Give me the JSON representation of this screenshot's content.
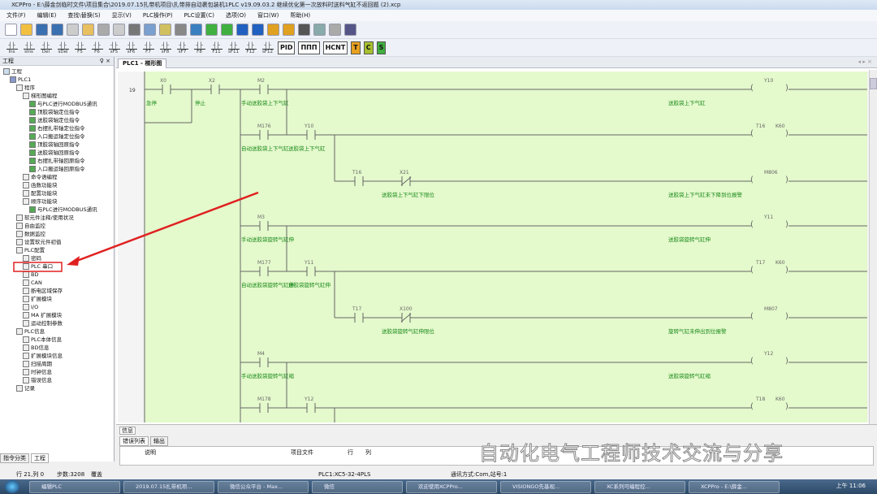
{
  "window": {
    "title": "XCPPro - E:\\薛金剑临时文件\\项目集合\\2019.07.15扎带机项目\\扎带排自动裹包装机1PLC v19.09.03.2 继续优化第一次放料时送料气缸不返回题 (2).xcp"
  },
  "menu": [
    "文件(F)",
    "编辑(E)",
    "查找\\替换(S)",
    "显示(V)",
    "PLC操作(P)",
    "PLC设置(C)",
    "选项(O)",
    "窗口(W)",
    "帮助(H)"
  ],
  "toolbar2": [
    "Ins",
    "sIns",
    "Del",
    "sDel",
    "F5",
    "F6",
    "sF5",
    "sF6",
    "F7",
    "sF8",
    "sF7",
    "F8",
    "F11",
    "sF11",
    "F12",
    "sF12"
  ],
  "toolbar2_big": [
    "PID",
    "ΠΠΠ",
    "HCNT",
    "T",
    "C",
    "S"
  ],
  "left_panel": {
    "title": "工程",
    "pin": "♀ ×",
    "tabs": [
      "指令分类",
      "工程"
    ]
  },
  "tree": [
    {
      "label": "工程",
      "level": 0
    },
    {
      "label": "PLC1",
      "level": 1
    },
    {
      "label": "程序",
      "level": 2
    },
    {
      "label": "梯形图编程",
      "level": 3
    },
    {
      "label": "与PLC进行MODBUS通讯",
      "level": 4
    },
    {
      "label": "顶胶袋轴定位指令",
      "level": 4
    },
    {
      "label": "送胶袋轴定位指令",
      "level": 4
    },
    {
      "label": "右摆扎带轴定位指令",
      "level": 4
    },
    {
      "label": "入口搬运轴定位指令",
      "level": 4
    },
    {
      "label": "顶胶袋轴回原指令",
      "level": 4
    },
    {
      "label": "送胶袋轴回原指令",
      "level": 4
    },
    {
      "label": "右摆扎带轴回原指令",
      "level": 4
    },
    {
      "label": "入口搬运轴回原指令",
      "level": 4
    },
    {
      "label": "命令语编程",
      "level": 3
    },
    {
      "label": "函数功能块",
      "level": 3
    },
    {
      "label": "配置功能块",
      "level": 3
    },
    {
      "label": "顺序功能块",
      "level": 3
    },
    {
      "label": "与PLC进行MODBUS通讯",
      "level": 4
    },
    {
      "label": "软元件注释/使用状况",
      "level": 2
    },
    {
      "label": "自由监控",
      "level": 2
    },
    {
      "label": "数据监控",
      "level": 2
    },
    {
      "label": "设置软元件初值",
      "level": 2
    },
    {
      "label": "PLC配置",
      "level": 2
    },
    {
      "label": "密码",
      "level": 3
    },
    {
      "label": "PLC 串口",
      "level": 3,
      "highlight": true
    },
    {
      "label": "BD",
      "level": 3
    },
    {
      "label": "CAN",
      "level": 3
    },
    {
      "label": "断电区域保存",
      "level": 3
    },
    {
      "label": "扩展模块",
      "level": 3
    },
    {
      "label": "I/O",
      "level": 3
    },
    {
      "label": "MA 扩展模块",
      "level": 3
    },
    {
      "label": "运动控制参数",
      "level": 3
    },
    {
      "label": "PLC信息",
      "level": 2
    },
    {
      "label": "PLC本体信息",
      "level": 3
    },
    {
      "label": "BD信息",
      "level": 3
    },
    {
      "label": "扩展模块信息",
      "level": 3
    },
    {
      "label": "扫描周期",
      "level": 3
    },
    {
      "label": "时钟信息",
      "level": 3
    },
    {
      "label": "错误信息",
      "level": 3
    },
    {
      "label": "记录",
      "level": 2
    }
  ],
  "editor": {
    "tab": "PLC1 - 梯形图"
  },
  "ladder": {
    "row_number": "19",
    "estop": {
      "name": "X0",
      "comment": "急停"
    },
    "stop": {
      "name": "X2",
      "comment": "停止"
    },
    "groups": [
      {
        "manual": {
          "name": "M2",
          "comment": "手动送胶袋上下气缸"
        },
        "auto": {
          "name": "M176",
          "comment": "自动送胶袋上下气缸"
        },
        "fb": {
          "name": "Y10",
          "comment": "送胶袋上下气缸"
        },
        "tc": {
          "name": "T16"
        },
        "sensor": {
          "name": "X21",
          "comment": "送胶袋上下气缸下限位"
        },
        "coil": {
          "name": "Y10",
          "comment": "送胶袋上下气缸"
        },
        "timer": {
          "name": "T16",
          "value": "K60"
        },
        "alarm": {
          "name": "M806",
          "comment": "送胶袋上下气缸未下降到位报警"
        }
      },
      {
        "manual": {
          "name": "M3",
          "comment": "手动送胶袋旋转气缸伸"
        },
        "auto": {
          "name": "M177",
          "comment": "自动送胶袋旋转气缸伸"
        },
        "fb": {
          "name": "Y11",
          "comment": "送胶袋旋转气缸伸"
        },
        "tc": {
          "name": "T17"
        },
        "sensor": {
          "name": "X100",
          "comment": "送胶袋旋转气缸伸限位"
        },
        "coil": {
          "name": "Y11",
          "comment": "送胶袋旋转气缸伸"
        },
        "timer": {
          "name": "T17",
          "value": "K60"
        },
        "alarm": {
          "name": "M807",
          "comment": "旋转气缸未伸出到位报警"
        }
      },
      {
        "manual": {
          "name": "M4",
          "comment": "手动送胶袋旋转气缸缩"
        },
        "auto": {
          "name": "M178"
        },
        "fb": {
          "name": "Y12"
        },
        "coil": {
          "name": "Y12",
          "comment": "送胶袋旋转气缸缩"
        },
        "timer": {
          "name": "T18",
          "value": "K60"
        }
      }
    ]
  },
  "info_panel": {
    "title": "信息",
    "tabs": [
      "错误列表",
      "输出"
    ],
    "columns": [
      "说明",
      "项目文件",
      "行",
      "列"
    ]
  },
  "status": {
    "position": "行 21,列 0",
    "steps": "步数:3208",
    "mode": "覆盖",
    "plc": "PLC1:XC5-32-4PLS",
    "comm": "通讯方式:Com,站号:1"
  },
  "watermark": "自动化电气工程师技术交流与分享",
  "taskbar": {
    "items": [
      "编辑PLC",
      "2019.07.15扎带机项...",
      "微信公众平台 - Max...",
      "微信",
      "欢迎使用XCPPro...",
      "VISIONGO先基视...",
      "XC系列可编程控...",
      "XCPPro - E:\\薛金..."
    ],
    "clock": "上午 11:06"
  },
  "colors": {
    "ladder_bg": "#e4f9cc",
    "comment": "#1a8a1a",
    "highlight": "#e02020"
  }
}
